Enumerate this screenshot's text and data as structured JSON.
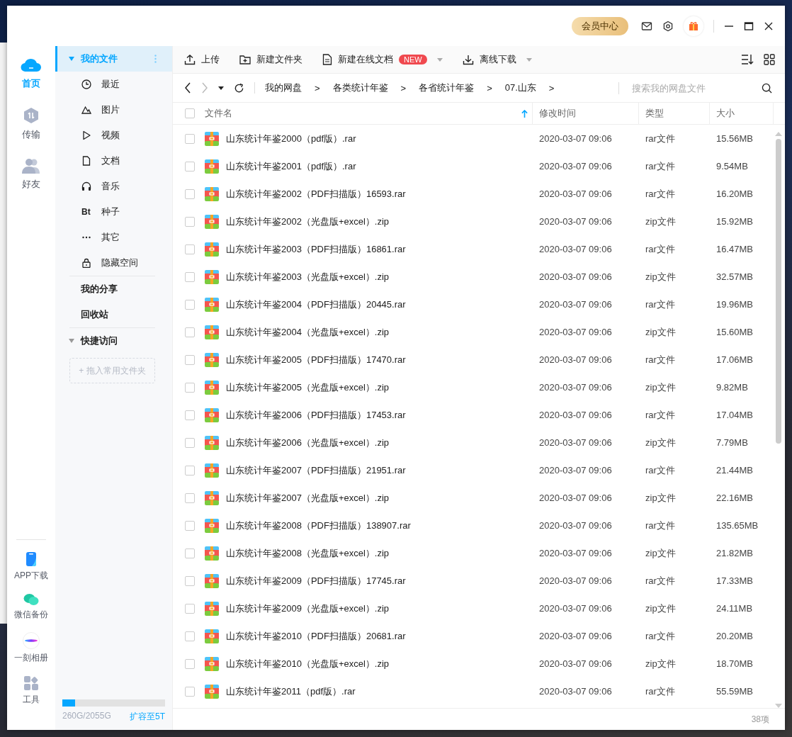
{
  "titlebar": {
    "vip_button": "会员中心"
  },
  "nav": {
    "items": [
      {
        "label": "首页",
        "selected": true
      },
      {
        "label": "传输",
        "selected": false
      },
      {
        "label": "好友",
        "selected": false
      }
    ],
    "bottom_items": [
      {
        "label": "APP下载"
      },
      {
        "label": "微信备份"
      },
      {
        "label": "一刻相册"
      },
      {
        "label": "工具"
      }
    ]
  },
  "sidebar": {
    "my_files": {
      "label": "我的文件",
      "selected": true,
      "expanded": true,
      "children": [
        {
          "label": "最近",
          "selected": false
        },
        {
          "label": "图片",
          "selected": false
        },
        {
          "label": "视频",
          "selected": false
        },
        {
          "label": "文档",
          "selected": false
        },
        {
          "label": "音乐",
          "selected": false
        },
        {
          "label": "种子",
          "icon_text": "Bt",
          "selected": false
        },
        {
          "label": "其它",
          "selected": false
        },
        {
          "label": "隐藏空间",
          "selected": false
        }
      ]
    },
    "sections": [
      {
        "label": "我的分享",
        "selected": false
      },
      {
        "label": "回收站",
        "selected": false
      }
    ],
    "quick_access": {
      "label": "快捷访问",
      "expanded": true,
      "drop_hint": "+ 拖入常用文件夹"
    },
    "storage": {
      "level": 0.127,
      "usage": "260G/2055G",
      "upgrade_link": "扩容至5T"
    }
  },
  "toolbar": {
    "buttons": [
      {
        "label": "上传",
        "dropdown": false
      },
      {
        "label": "新建文件夹",
        "dropdown": false
      },
      {
        "label": "新建在线文档",
        "badge": "NEW",
        "dropdown": true
      },
      {
        "label": "离线下载",
        "dropdown": true
      }
    ]
  },
  "breadcrumb": {
    "items": [
      {
        "label": "我的网盘",
        "separator": ">"
      },
      {
        "label": "各类统计年鉴",
        "separator": ">"
      },
      {
        "label": "各省统计年鉴",
        "separator": ">"
      },
      {
        "label": "07.山东",
        "separator": ">"
      }
    ],
    "search": {
      "placeholder": "搜索我的网盘文件"
    }
  },
  "table": {
    "header_checked": false,
    "columns": [
      {
        "label": "文件名",
        "sorted": true
      },
      {
        "label": "修改时间",
        "sorted": false
      },
      {
        "label": "类型",
        "sorted": false
      },
      {
        "label": "大小",
        "sorted": false
      }
    ],
    "rows": [
      {
        "name": "山东统计年鉴2000（pdf版）.rar",
        "modified": "2020-03-07 09:06",
        "type": "rar文件",
        "size": "15.56MB",
        "selected": false
      },
      {
        "name": "山东统计年鉴2001（pdf版）.rar",
        "modified": "2020-03-07 09:06",
        "type": "rar文件",
        "size": "9.54MB",
        "selected": false
      },
      {
        "name": "山东统计年鉴2002（PDF扫描版）16593.rar",
        "modified": "2020-03-07 09:06",
        "type": "rar文件",
        "size": "16.20MB",
        "selected": false
      },
      {
        "name": "山东统计年鉴2002（光盘版+excel）.zip",
        "modified": "2020-03-07 09:06",
        "type": "zip文件",
        "size": "15.92MB",
        "selected": false
      },
      {
        "name": "山东统计年鉴2003（PDF扫描版）16861.rar",
        "modified": "2020-03-07 09:06",
        "type": "rar文件",
        "size": "16.47MB",
        "selected": false
      },
      {
        "name": "山东统计年鉴2003（光盘版+excel）.zip",
        "modified": "2020-03-07 09:06",
        "type": "zip文件",
        "size": "32.57MB",
        "selected": false
      },
      {
        "name": "山东统计年鉴2004（PDF扫描版）20445.rar",
        "modified": "2020-03-07 09:06",
        "type": "rar文件",
        "size": "19.96MB",
        "selected": false
      },
      {
        "name": "山东统计年鉴2004（光盘版+excel）.zip",
        "modified": "2020-03-07 09:06",
        "type": "zip文件",
        "size": "15.60MB",
        "selected": false
      },
      {
        "name": "山东统计年鉴2005（PDF扫描版）17470.rar",
        "modified": "2020-03-07 09:06",
        "type": "rar文件",
        "size": "17.06MB",
        "selected": false
      },
      {
        "name": "山东统计年鉴2005（光盘版+excel）.zip",
        "modified": "2020-03-07 09:06",
        "type": "zip文件",
        "size": "9.82MB",
        "selected": false
      },
      {
        "name": "山东统计年鉴2006（PDF扫描版）17453.rar",
        "modified": "2020-03-07 09:06",
        "type": "rar文件",
        "size": "17.04MB",
        "selected": false
      },
      {
        "name": "山东统计年鉴2006（光盘版+excel）.zip",
        "modified": "2020-03-07 09:06",
        "type": "zip文件",
        "size": "7.79MB",
        "selected": false
      },
      {
        "name": "山东统计年鉴2007（PDF扫描版）21951.rar",
        "modified": "2020-03-07 09:06",
        "type": "rar文件",
        "size": "21.44MB",
        "selected": false
      },
      {
        "name": "山东统计年鉴2007（光盘版+excel）.zip",
        "modified": "2020-03-07 09:06",
        "type": "zip文件",
        "size": "22.16MB",
        "selected": false
      },
      {
        "name": "山东统计年鉴2008（PDF扫描版）138907.rar",
        "modified": "2020-03-07 09:06",
        "type": "rar文件",
        "size": "135.65MB",
        "selected": false
      },
      {
        "name": "山东统计年鉴2008（光盘版+excel）.zip",
        "modified": "2020-03-07 09:06",
        "type": "zip文件",
        "size": "21.82MB",
        "selected": false
      },
      {
        "name": "山东统计年鉴2009（PDF扫描版）17745.rar",
        "modified": "2020-03-07 09:06",
        "type": "rar文件",
        "size": "17.33MB",
        "selected": false
      },
      {
        "name": "山东统计年鉴2009（光盘版+excel）.zip",
        "modified": "2020-03-07 09:06",
        "type": "zip文件",
        "size": "24.11MB",
        "selected": false
      },
      {
        "name": "山东统计年鉴2010（PDF扫描版）20681.rar",
        "modified": "2020-03-07 09:06",
        "type": "rar文件",
        "size": "20.20MB",
        "selected": false
      },
      {
        "name": "山东统计年鉴2010（光盘版+excel）.zip",
        "modified": "2020-03-07 09:06",
        "type": "zip文件",
        "size": "18.70MB",
        "selected": false
      },
      {
        "name": "山东统计年鉴2011（pdf版）.rar",
        "modified": "2020-03-07 09:06",
        "type": "rar文件",
        "size": "55.59MB",
        "selected": false
      }
    ]
  },
  "status_bar": {
    "count": "38项"
  }
}
